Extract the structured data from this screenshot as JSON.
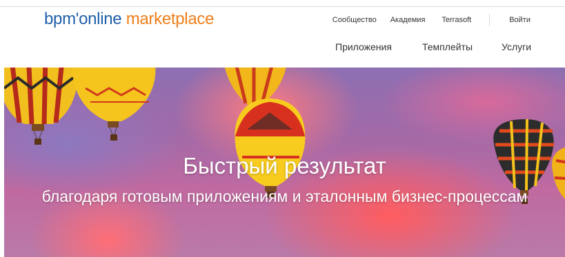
{
  "header": {
    "logo_part1": "bpm'online",
    "logo_part2": " marketplace",
    "top_links": [
      "Сообщество",
      "Академия",
      "Terrasoft"
    ],
    "login": "Войти",
    "nav": [
      "Приложения",
      "Темплейты",
      "Услуги"
    ]
  },
  "hero": {
    "title": "Быстрый результат",
    "subtitle": "благодаря готовым приложениям и эталонным бизнес-процессам"
  },
  "colors": {
    "logo_blue": "#1f5fa8",
    "logo_orange": "#ef7f1a"
  }
}
